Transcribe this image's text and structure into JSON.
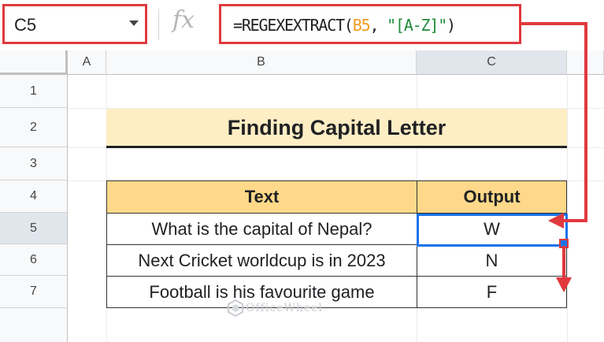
{
  "name_box": {
    "cell_ref": "C5"
  },
  "formula_bar": {
    "fx_label": "fx",
    "formula_prefix": "=REGEXEXTRACT(",
    "formula_ref": "B5",
    "formula_sep": ", ",
    "formula_string": "\"[A-Z]\"",
    "formula_suffix": ")"
  },
  "columns": [
    "A",
    "B",
    "C"
  ],
  "rows": [
    "1",
    "2",
    "3",
    "4",
    "5",
    "6",
    "7"
  ],
  "sheet": {
    "title": "Finding Capital Letter",
    "table_headers": [
      "Text",
      "Output"
    ],
    "table_rows": [
      {
        "text": "What is the capital of Nepal?",
        "output": "W"
      },
      {
        "text": "Next Cricket worldcup is in 2023",
        "output": "N"
      },
      {
        "text": "Football is his favourite game",
        "output": "F"
      }
    ]
  },
  "watermark": {
    "text": "OfficeWheel"
  },
  "colors": {
    "highlight_red": "#e0393e",
    "selection_blue": "#1a73e8",
    "title_fill": "#ffeec4",
    "header_fill": "#ffd989"
  }
}
